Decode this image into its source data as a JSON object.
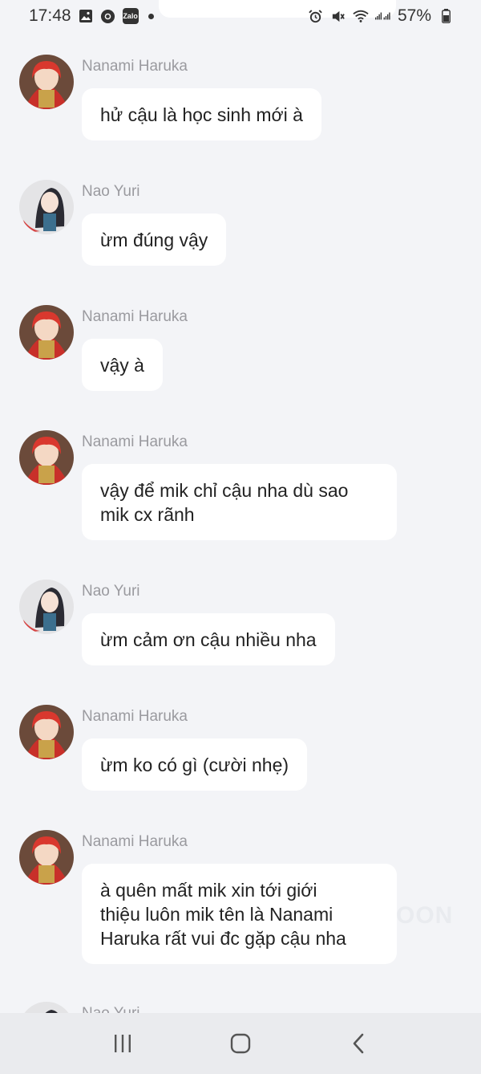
{
  "status": {
    "time": "17:48",
    "battery": "57%",
    "icons": [
      "image-icon",
      "chrome-icon",
      "zalo-icon",
      "alarm-icon",
      "mute-icon",
      "wifi-icon",
      "signal-icon"
    ],
    "zalo_label": "Zalo"
  },
  "messages": [
    {
      "sender": "Nanami Haruka",
      "avatar": "nanami",
      "text": "hử cậu là học sinh mới à"
    },
    {
      "sender": "Nao Yuri",
      "avatar": "nao",
      "text": "ừm đúng vậy"
    },
    {
      "sender": "Nanami Haruka",
      "avatar": "nanami",
      "text": "vậy à"
    },
    {
      "sender": "Nanami Haruka",
      "avatar": "nanami",
      "text": "vậy để mik chỉ cậu nha dù sao\nmik cx rãnh"
    },
    {
      "sender": "Nao Yuri",
      "avatar": "nao",
      "text": "ừm cảm ơn cậu nhiều nha"
    },
    {
      "sender": "Nanami Haruka",
      "avatar": "nanami",
      "text": "ừm ko có gì (cười nhẹ)"
    },
    {
      "sender": "Nanami Haruka",
      "avatar": "nanami",
      "text": "à quên mất mik xin tới giới\nthiệu luôn mik tên là Nanami\nHaruka rất vui đc gặp cậu nha"
    },
    {
      "sender": "Nao Yuri",
      "avatar": "nao",
      "text": ""
    }
  ],
  "watermark": "OON",
  "nav": {
    "recents_icon": "recents-icon",
    "home_icon": "home-icon",
    "back_icon": "back-icon"
  },
  "colors": {
    "background": "#f3f4f7",
    "bubble": "#ffffff",
    "sender": "#9a9a9f",
    "nanami_hair": "#c8302a",
    "nao_hair": "#2b2b33"
  }
}
